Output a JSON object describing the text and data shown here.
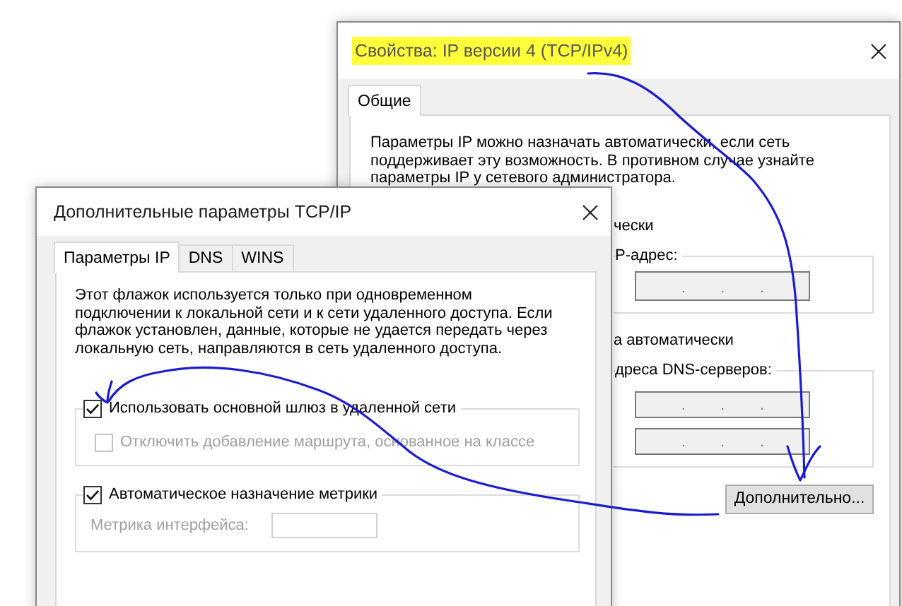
{
  "back_window": {
    "title": "Свойства: IP версии 4 (TCP/IPv4)",
    "title_highlighted": true,
    "tabs": [
      {
        "label": "Общие",
        "selected": true
      }
    ],
    "description_lines": [
      "Параметры IP можно назначать автоматически, если сеть",
      "поддерживает эту возможность. В противном случае узнайте",
      "параметры IP у сетевого администратора."
    ],
    "content": [
      {
        "kind": "text",
        "text": "чески"
      },
      {
        "kind": "group",
        "label": "P-адрес:",
        "fields": [
          {
            "separators": [
              ".",
              ".",
              "."
            ],
            "disabled": true
          }
        ]
      },
      {
        "kind": "text",
        "text": "а автоматически"
      },
      {
        "kind": "group",
        "label": "дреса DNS-серверов:",
        "fields": [
          {
            "separators": [
              ".",
              ".",
              "."
            ],
            "disabled": true
          },
          {
            "separators": [
              ".",
              ".",
              "."
            ],
            "disabled": true
          }
        ]
      },
      {
        "kind": "button",
        "label": "Дополнительно..."
      }
    ]
  },
  "front_window": {
    "title": "Дополнительные параметры TCP/IP",
    "title_highlighted": false,
    "tabs": [
      {
        "label": "Параметры IP",
        "selected": true
      },
      {
        "label": "DNS",
        "selected": false
      },
      {
        "label": "WINS",
        "selected": false
      }
    ],
    "description_lines": [
      "Этот флажок используется только при одновременном",
      "подключении к локальной сети и к сети удаленного доступа. Если",
      "флажок установлен, данные, которые не удается передать через",
      "локальную сеть, направляются в сеть удаленного доступа."
    ],
    "groups": [
      {
        "header": {
          "label": "Использовать основной шлюз в удаленной сети",
          "checked": true,
          "disabled": false
        },
        "items": [
          {
            "kind": "checkbox",
            "label": "Отключить добавление маршрута, основанное на классе",
            "checked": false,
            "disabled": true
          }
        ]
      },
      {
        "header": {
          "label": "Автоматическое назначение метрики",
          "checked": true,
          "disabled": false
        },
        "items": [
          {
            "kind": "field",
            "label": "Метрика интерфейса:",
            "disabled": true
          }
        ]
      }
    ]
  }
}
